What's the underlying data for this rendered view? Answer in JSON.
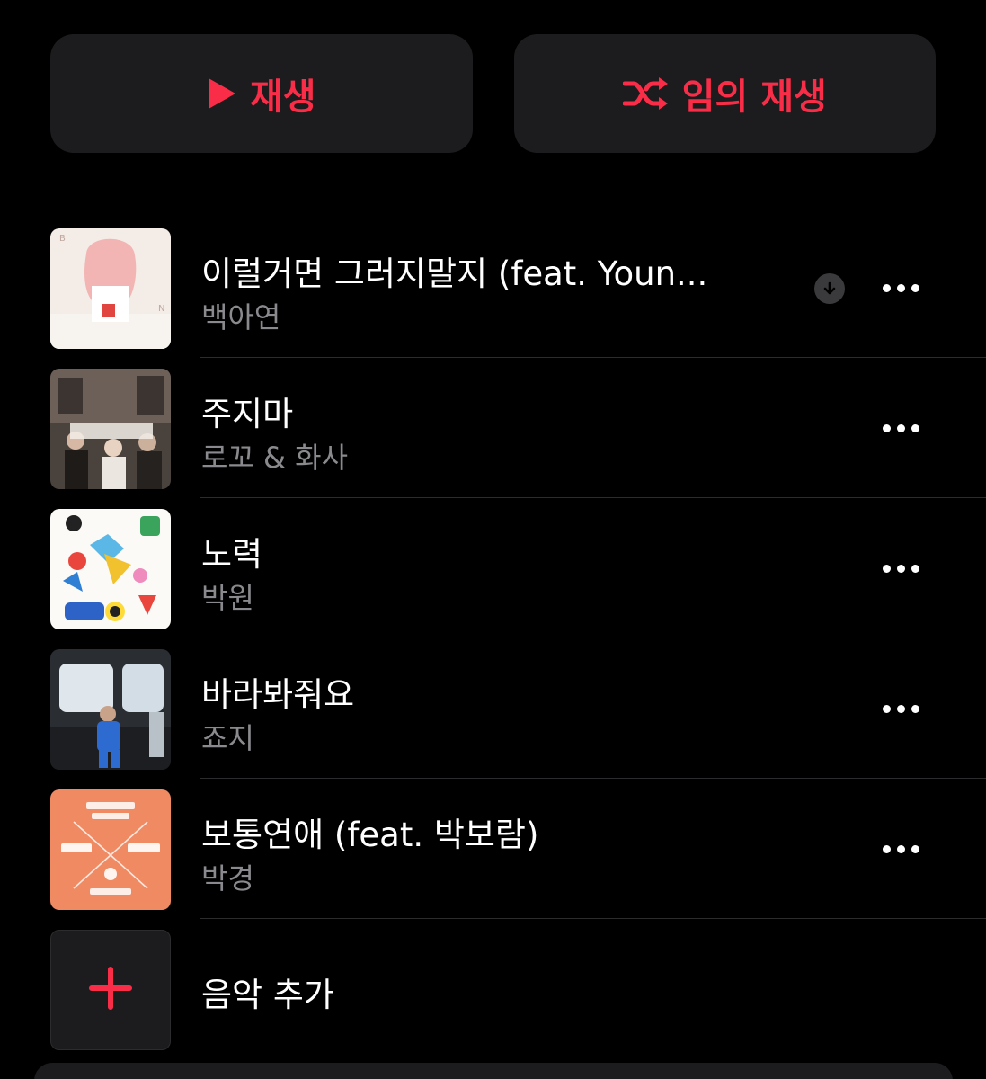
{
  "actions": {
    "play_label": "재생",
    "shuffle_label": "임의 재생",
    "accent_color": "#fa2d48"
  },
  "songs": [
    {
      "title": "이럴거면 그러지말지 (feat. Youn...",
      "artist": "백아연",
      "downloadable": true,
      "artwork": "pink-portrait-artwork"
    },
    {
      "title": "주지마",
      "artist": "로꼬 & 화사",
      "downloadable": false,
      "artwork": "group-photo-artwork"
    },
    {
      "title": "노력",
      "artist": "박원",
      "downloadable": false,
      "artwork": "doodle-illustration-artwork"
    },
    {
      "title": "바라봐줘요",
      "artist": "죠지",
      "downloadable": false,
      "artwork": "subway-photo-artwork"
    },
    {
      "title": "보통연애 (feat. 박보람)",
      "artist": "박경",
      "downloadable": false,
      "artwork": "orange-typography-artwork"
    }
  ],
  "add_music": {
    "label": "음악 추가"
  },
  "icons": {
    "play": "play-icon",
    "shuffle": "shuffle-icon",
    "more": "ellipsis-icon",
    "download": "download-icon",
    "add": "plus-icon"
  }
}
